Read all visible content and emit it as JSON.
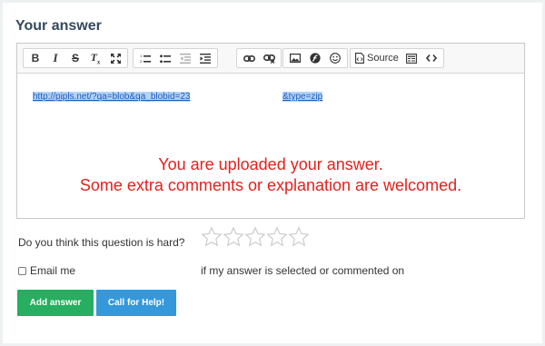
{
  "section": {
    "title": "Your answer"
  },
  "toolbar": {
    "source_label": "Source",
    "icons": [
      "bold-icon",
      "italic-icon",
      "strikethrough-icon",
      "remove-format-icon",
      "maximize-icon",
      "numbered-list-icon",
      "bulleted-list-icon",
      "outdent-icon",
      "indent-icon",
      "link-icon",
      "unlink-icon",
      "image-icon",
      "flash-icon",
      "smiley-icon",
      "source-icon",
      "template-icon",
      "code-icon"
    ]
  },
  "editor": {
    "link_part1": "http://pipls.net/?qa=blob&qa_blobid=23",
    "link_part2": "&type=zip",
    "message_line1": "You are uploaded your answer.",
    "message_line2": "Some extra comments or explanation are welcomed.",
    "message_color": "#e5201c"
  },
  "question": {
    "label": "Do you think this question is hard?",
    "rating": 0,
    "max_stars": 5
  },
  "notify": {
    "email_label": "Email me",
    "tail_label": "if my answer is selected or commented on",
    "checked": false
  },
  "buttons": {
    "add_answer": "Add answer",
    "call_help": "Call for Help!",
    "add_color": "#27ae60",
    "help_color": "#3498db"
  }
}
